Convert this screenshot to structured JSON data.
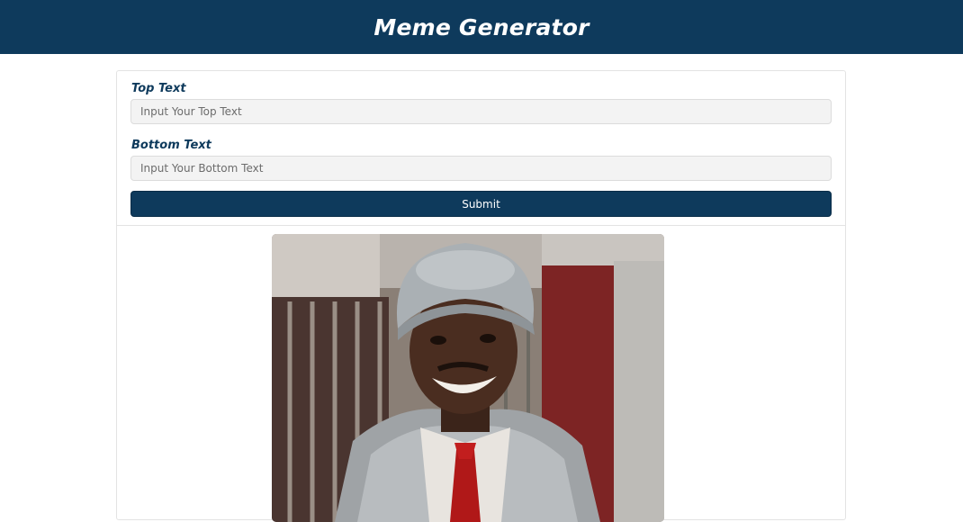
{
  "header": {
    "title": "Meme Generator"
  },
  "form": {
    "top": {
      "label": "Top Text",
      "placeholder": "Input Your Top Text",
      "value": ""
    },
    "bottom": {
      "label": "Bottom Text",
      "placeholder": "Input Your Bottom Text",
      "value": ""
    },
    "submit_label": "Submit"
  },
  "meme": {
    "image": "man-in-fur-hat-smiling-photo"
  },
  "colors": {
    "header_bg": "#0e3a5c",
    "button_bg": "#0e3a5c",
    "input_bg": "#f3f3f3"
  }
}
